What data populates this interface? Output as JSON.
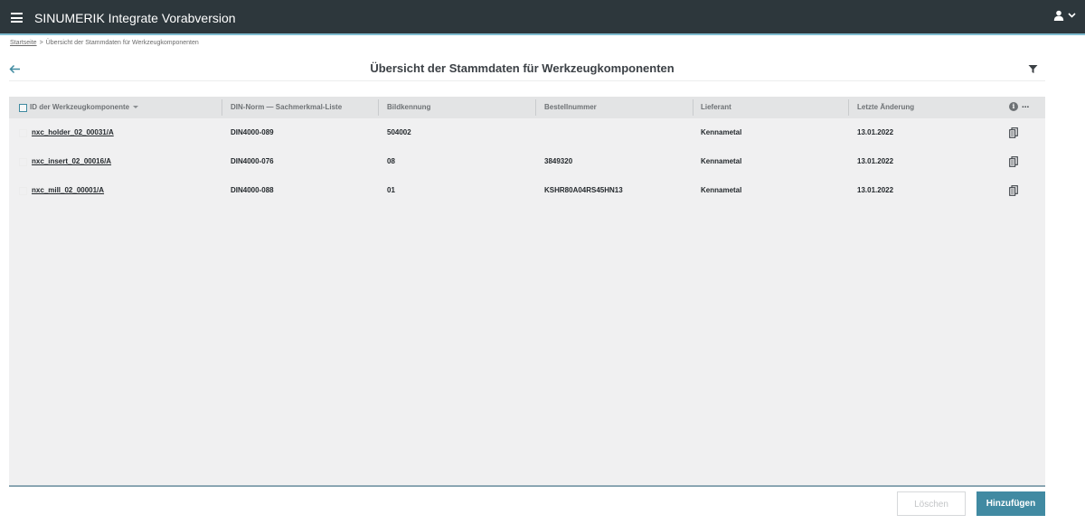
{
  "app": {
    "title": "SINUMERIK Integrate Vorabversion"
  },
  "breadcrumb": {
    "home": "Startseite",
    "separator": ">",
    "current": "Übersicht der Stammdaten für Werkzeugkomponenten"
  },
  "page": {
    "title": "Übersicht der Stammdaten für Werkzeugkomponenten"
  },
  "table": {
    "columns": [
      "ID der Werkzeugkomponente",
      "DIN-Norm — Sachmerkmal-Liste",
      "Bildkennung",
      "Bestellnummer",
      "Lieferant",
      "Letzte Änderung"
    ],
    "info_glyph": "i",
    "more_glyph": "...",
    "rows": [
      {
        "id": "nxc_holder_02_00031/A",
        "din": "DIN4000-089",
        "bild": "504002",
        "bestell": "",
        "lieferant": "Kennametal",
        "datum": "13.01.2022"
      },
      {
        "id": "nxc_insert_02_00016/A",
        "din": "DIN4000-076",
        "bild": "08",
        "bestell": "3849320",
        "lieferant": "Kennametal",
        "datum": "13.01.2022"
      },
      {
        "id": "nxc_mill_02_00001/A",
        "din": "DIN4000-088",
        "bild": "01",
        "bestell": "KSHR80A04RS45HN13",
        "lieferant": "Kennametal",
        "datum": "13.01.2022"
      }
    ]
  },
  "actions": {
    "delete_label": "Löschen",
    "add_label": "Hinzufügen"
  },
  "colors": {
    "header_bg": "#2d373c",
    "accent": "#418aa2",
    "table_bg": "#f0f0f1"
  },
  "icons": {
    "menu": "hamburger-icon",
    "user": "user-icon",
    "back": "arrow-left-icon",
    "filter": "filter-icon",
    "info": "info-icon",
    "copy": "copy-icon"
  }
}
